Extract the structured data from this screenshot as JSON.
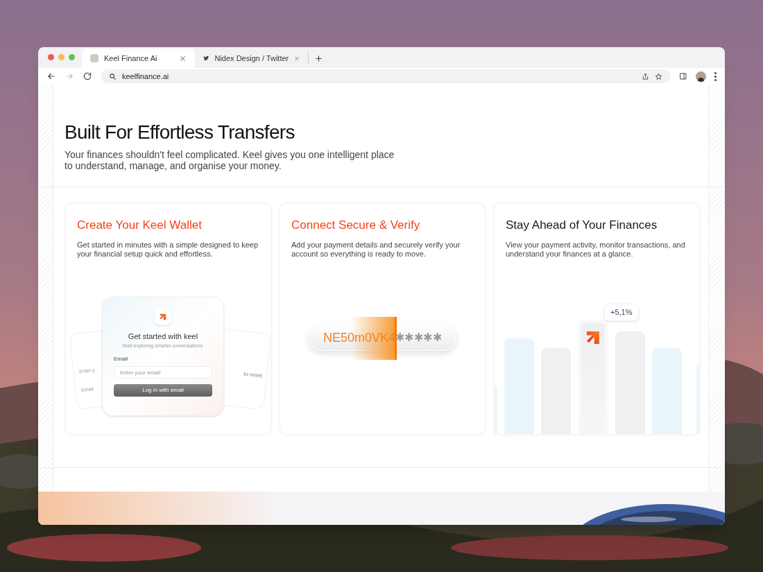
{
  "browser": {
    "tabs": [
      {
        "title": "Keel Finance Ai",
        "selected": true
      },
      {
        "title": "Nidex Design / Twitter",
        "selected": false
      }
    ],
    "url": "keelfinance.ai"
  },
  "hero": {
    "title": "Built For Effortless Transfers",
    "subtitle": "Your finances shouldn't feel complicated. Keel gives you one intelligent place to understand, manage, and organise your money."
  },
  "cards": [
    {
      "kind": "wallet",
      "accent": true,
      "title": "Create Your Keel Wallet",
      "text": "Get started in minutes with a simple designed to keep your financial setup quick and effortless.",
      "login": {
        "heading": "Get started with keel",
        "subheading": "Start exploring smarter conversations.",
        "label": "Email",
        "placeholder": "Enter your email",
        "button": "Log in with email",
        "back_left": [
          "Enter y",
          "Email"
        ],
        "back_right": "to reset."
      }
    },
    {
      "kind": "verify",
      "accent": true,
      "title": "Connect Secure & Verify",
      "text": "Add your payment details and securely verify your account so everything is ready to move.",
      "code": {
        "revealed": "NE50m0VK4",
        "masked": "✱✱✱✱✱"
      }
    },
    {
      "kind": "chart",
      "accent": false,
      "title": "Stay Ahead of Your Finances",
      "text": "View your payment activity, monitor transactions, and understand your finances at a glance.",
      "badge": "+5,1%"
    }
  ]
}
